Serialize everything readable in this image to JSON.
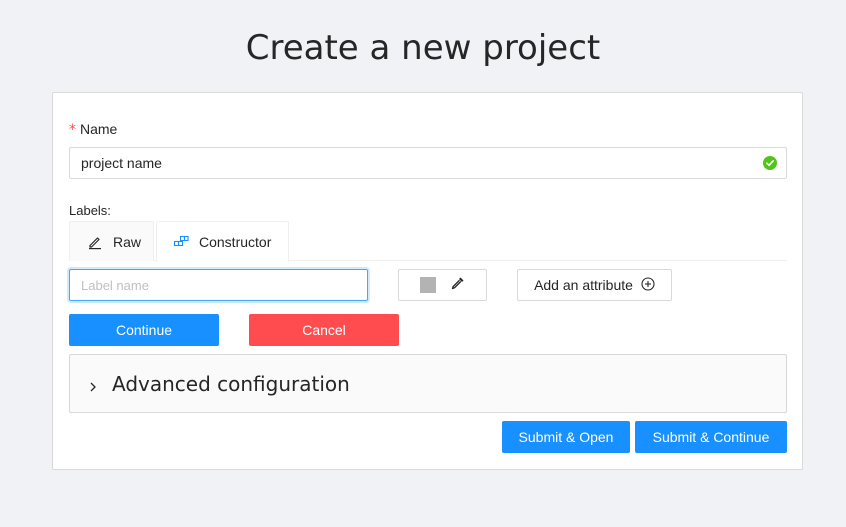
{
  "page": {
    "title": "Create a new project"
  },
  "form": {
    "name_label": "Name",
    "required_mark": "*",
    "name_value": "project name",
    "labels_label": "Labels:",
    "tabs": [
      {
        "label": "Raw",
        "icon": "edit-icon"
      },
      {
        "label": "Constructor",
        "icon": "build-icon"
      }
    ],
    "constructor": {
      "label_name_placeholder": "Label name",
      "label_color": "#b3b3b3",
      "add_attribute_label": "Add an attribute",
      "continue_label": "Continue",
      "cancel_label": "Cancel"
    },
    "advanced_label": "Advanced configuration",
    "submit_open_label": "Submit & Open",
    "submit_continue_label": "Submit & Continue"
  },
  "colors": {
    "primary": "#1890ff",
    "danger": "#ff4d4f",
    "success": "#52c41a"
  }
}
